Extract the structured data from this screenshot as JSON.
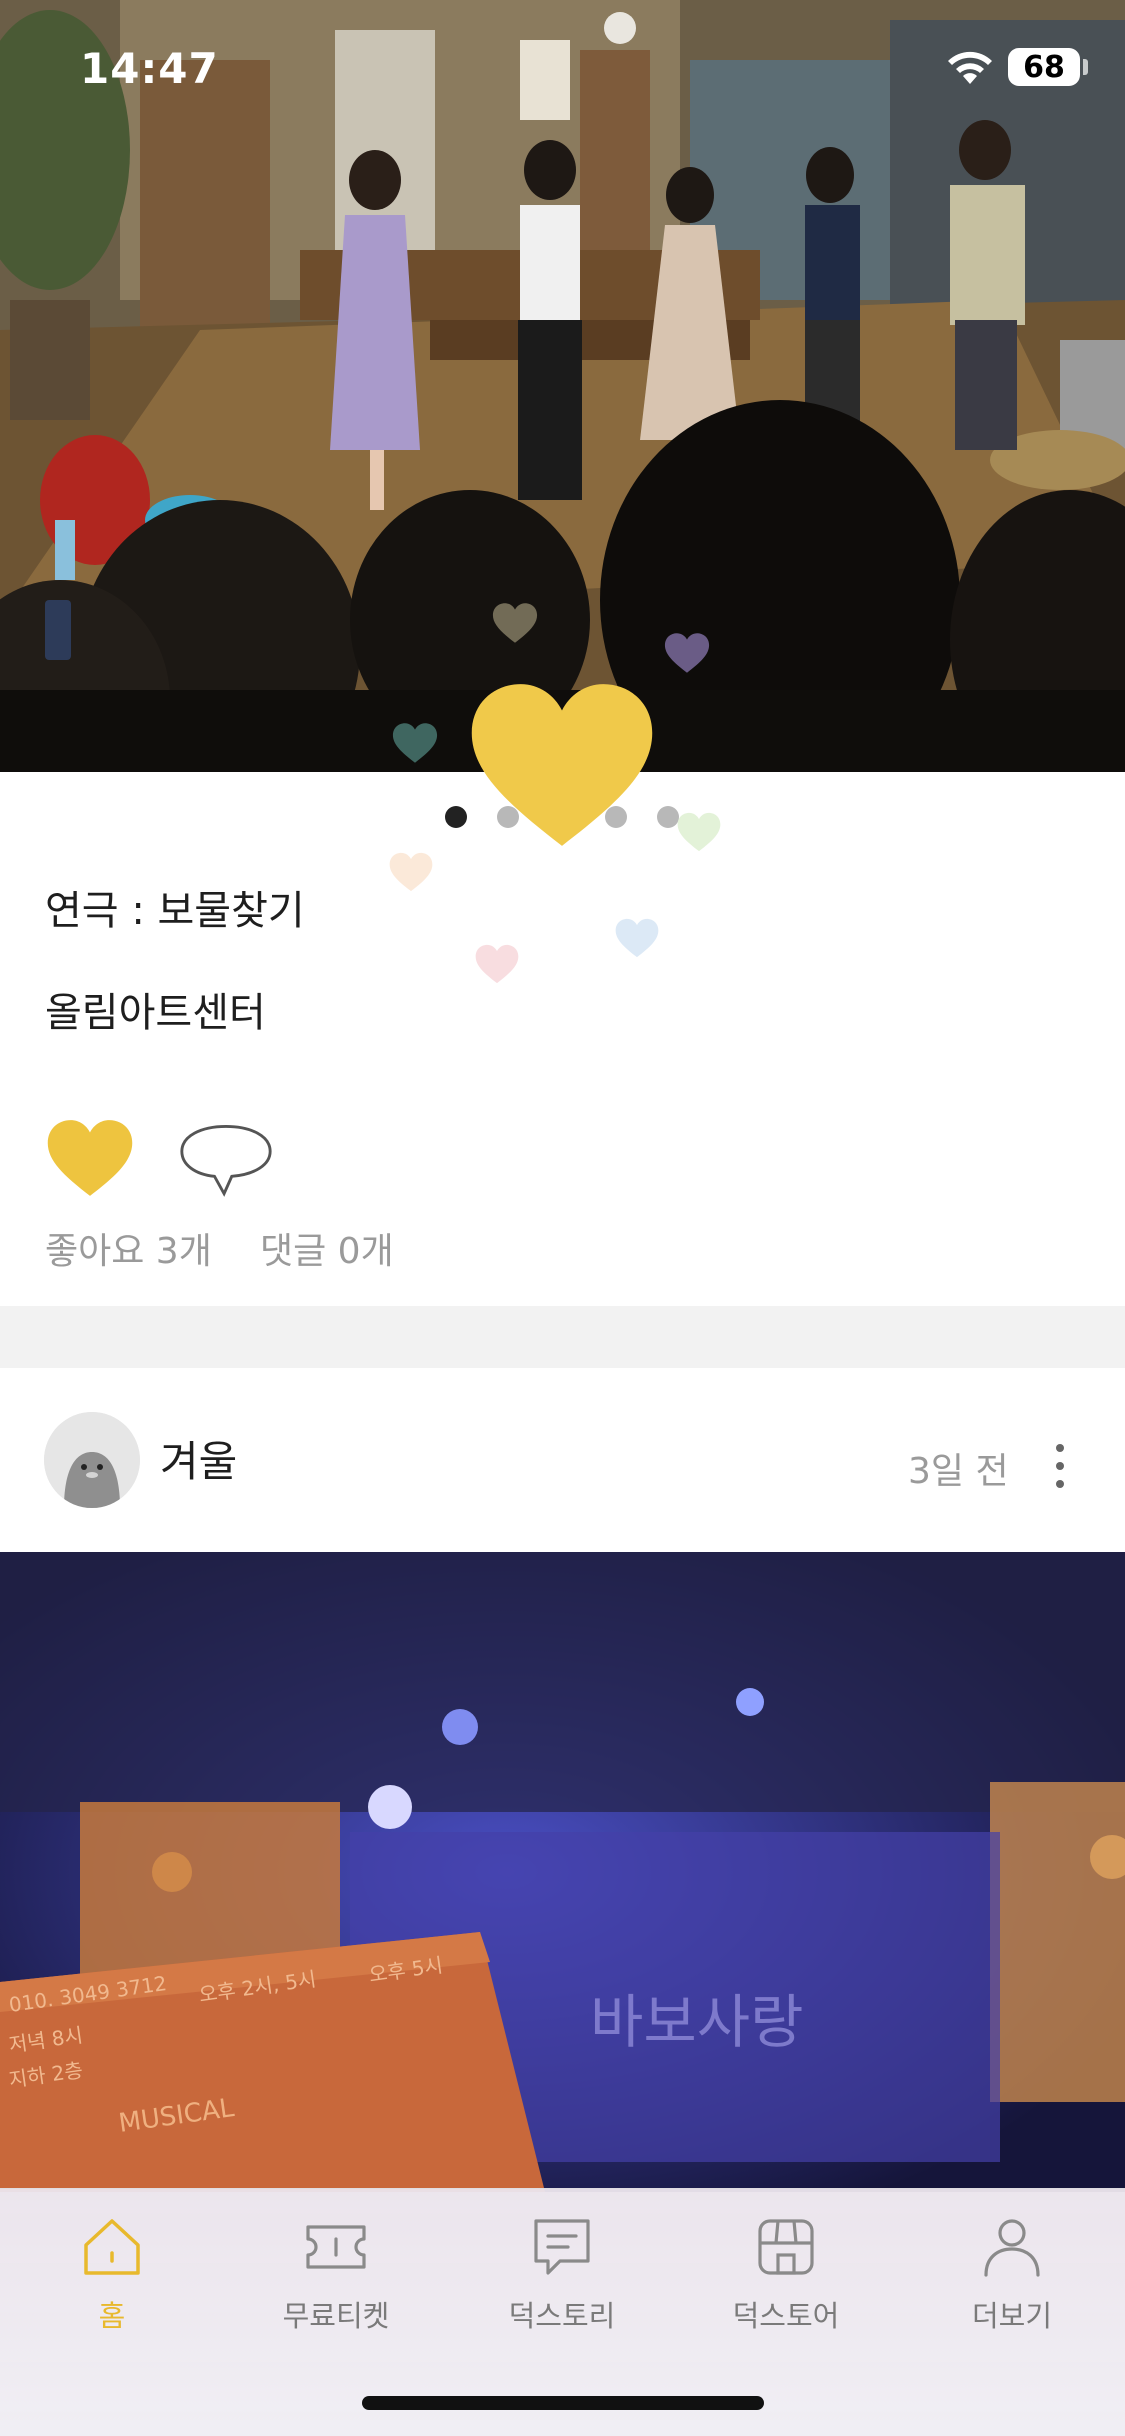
{
  "status_bar": {
    "time": "14:47",
    "battery": "68"
  },
  "post1": {
    "carousel": {
      "count": 5,
      "active_index": 0
    },
    "title": "연극 : 보물찾기",
    "venue": "올림아트센터",
    "liked": true,
    "likes_label": "좋아요 3개",
    "comments_label": "댓글 0개"
  },
  "post2": {
    "author": "겨울",
    "time_ago": "3일 전",
    "photo_caption_text": "바보사랑",
    "ticket_text": [
      "MUSICAL",
      "010. 3049 3712",
      "오후 2시, 5시",
      "오후 5시",
      "저녁 8시",
      "지하 2층"
    ]
  },
  "tab_bar": {
    "items": [
      {
        "label": "홈",
        "icon": "home-icon",
        "active": true
      },
      {
        "label": "무료티켓",
        "icon": "ticket-icon",
        "active": false
      },
      {
        "label": "덕스토리",
        "icon": "chat-bubble-icon",
        "active": false
      },
      {
        "label": "덕스토어",
        "icon": "store-icon",
        "active": false
      },
      {
        "label": "더보기",
        "icon": "person-icon",
        "active": false
      }
    ]
  },
  "colors": {
    "accent": "#e8c33f",
    "tab_active": "#e8b92d",
    "muted_text": "#9a9a9a",
    "section_gap": "#f2f2f2"
  }
}
